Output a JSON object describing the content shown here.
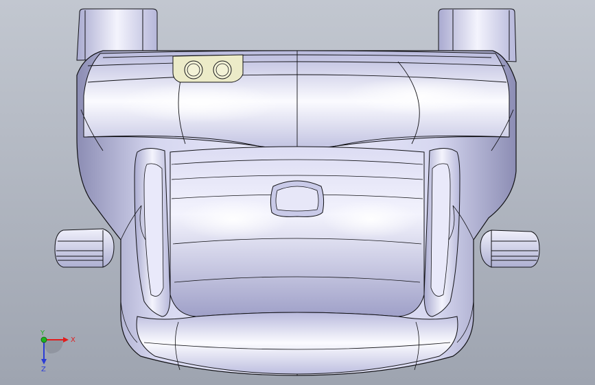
{
  "viewport": {
    "background_top": "#c2c7d0",
    "background_bottom": "#9ea4b0",
    "model_fill_light": "#f6f6fd",
    "model_fill_mid": "#cfd0ea",
    "model_fill_dark": "#8c8db4",
    "edge_color": "#101014",
    "sketch_fill": "#ecebc8"
  },
  "triad": {
    "x_label": "X",
    "y_label": "Y",
    "z_label": "Z",
    "x_color": "#e11d1d",
    "y_color": "#1fb31f",
    "z_color": "#2a3bd6"
  }
}
